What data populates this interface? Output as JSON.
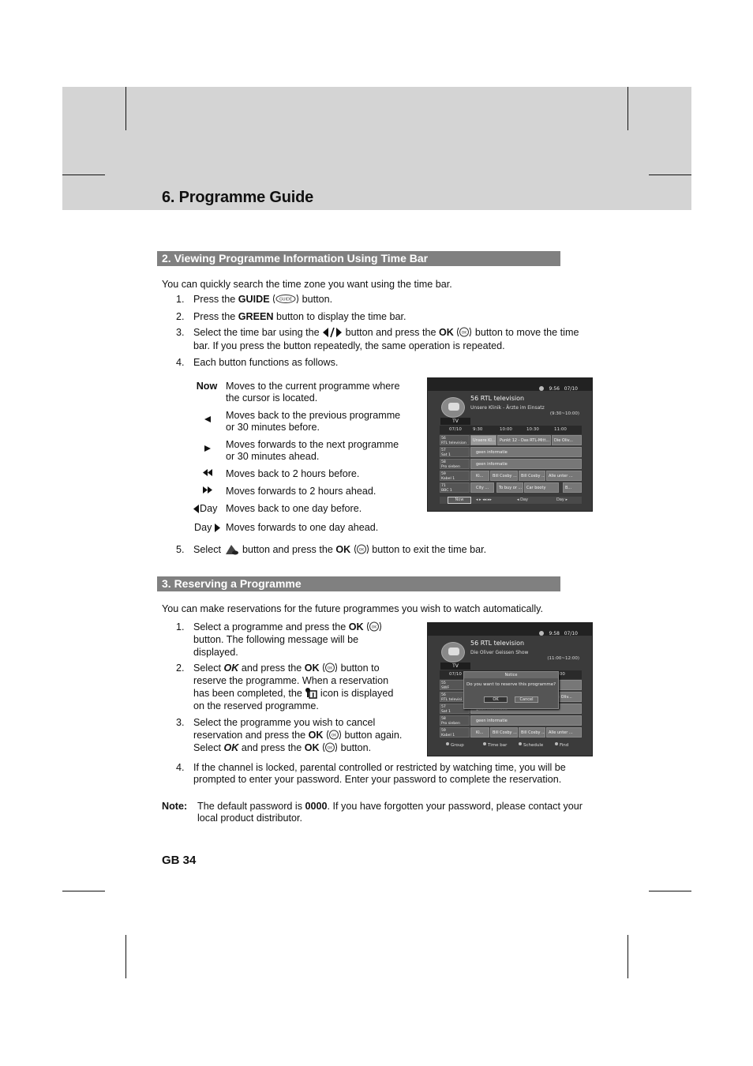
{
  "page": {
    "chapter_title": "6. Programme Guide",
    "page_number": "GB 34"
  },
  "section2": {
    "heading": "2. Viewing Programme Information Using Time Bar",
    "intro": "You can quickly search the time zone you want using the time bar.",
    "steps": [
      {
        "num": "1.",
        "pre": "Press the ",
        "bold": "GUIDE",
        "icon": "guide-button-icon",
        "post": " button."
      },
      {
        "num": "2.",
        "pre": "Press the ",
        "bold": "GREEN",
        "post": " button to display the time bar."
      },
      {
        "num": "3.",
        "pre": "Select the time bar using the ",
        "icon1": "left-right-arrow-icon",
        "mid": " button and press the ",
        "bold": "OK",
        "icon2": "ok-button-icon",
        "post": " button to move the time",
        "line2": "bar. If you press the button repeatedly, the same operation is repeated."
      },
      {
        "num": "4.",
        "text": "Each button functions as follows."
      },
      {
        "num": "5.",
        "pre": "Select ",
        "icon1": "exit-button-icon",
        "mid": " button and press the ",
        "bold": "OK",
        "icon2": "ok-button-icon",
        "post": " button to exit the time bar."
      }
    ],
    "functions": [
      {
        "key": "Now",
        "icon": "",
        "lines": [
          "Moves to the current programme where",
          "the cursor is located."
        ]
      },
      {
        "key": "",
        "icon": "left-arrow-icon",
        "lines": [
          "Moves back to the previous programme",
          "or 30 minutes before."
        ]
      },
      {
        "key": "",
        "icon": "right-arrow-icon",
        "lines": [
          "Moves forwards to the next programme",
          "or 30 minutes ahead."
        ]
      },
      {
        "key": "",
        "icon": "rewind-icon",
        "lines": [
          "Moves back to 2 hours before."
        ]
      },
      {
        "key": "",
        "icon": "fast-forward-icon",
        "lines": [
          "Moves forwards to 2 hours ahead."
        ]
      },
      {
        "key": "Day",
        "icon": "day-back-icon",
        "lines": [
          "Moves back to one day before."
        ]
      },
      {
        "key": "Day",
        "icon": "day-forward-icon",
        "lines": [
          "Moves forwards to one day ahead."
        ]
      }
    ]
  },
  "section3": {
    "heading": "3. Reserving a Programme",
    "intro": "You can make reservations for the future programmes you wish to watch automatically.",
    "steps": [
      {
        "num": "1.",
        "lines": [
          "Select a programme and press the |OK|",
          "button. The following message will be",
          "displayed."
        ]
      },
      {
        "num": "2.",
        "lines": [
          "Select OK and press the OK button to",
          "reserve the programme. When a reservation",
          "has been completed, the icon is displayed",
          "on the reserved programme."
        ]
      },
      {
        "num": "3.",
        "lines": [
          "Select the programme you wish to cancel",
          "reservation and press the OK button again.",
          "Select OK and press the OK button."
        ]
      },
      {
        "num": "4.",
        "lines": [
          "If the channel is locked, parental controlled or restricted by watching time, you will be",
          "prompted to enter your password. Enter your password to complete the reservation."
        ]
      }
    ],
    "words": {
      "select": "Select ",
      "ok": "OK",
      "and_press_the": " and press the ",
      "button_to": " button to",
      "button_again": " button again.",
      "button_end": " button.",
      "s1a": "Select a programme and press the ",
      "s1b": "button. The following message will be",
      "s1c": "displayed.",
      "s2b": "reserve the programme. When a reservation",
      "s2c_pre": "has been completed, the ",
      "s2c_post": " icon is displayed",
      "s2d": "on the reserved programme.",
      "s3a": "Select the programme you wish to cancel",
      "s3b": "reservation and press the ",
      "s4a": "If the channel is locked, parental controlled or restricted by watching time, you will be",
      "s4b": "prompted to enter your password. Enter your password to complete the reservation."
    }
  },
  "note": {
    "label": "Note:",
    "pre": "The default password is ",
    "password": "0000",
    "post": ". If you have forgotten your password, please contact your",
    "line2": "local product distributor."
  },
  "screen1": {
    "clock": "9:56",
    "date": "07/10",
    "channel": "56 RTL television",
    "programme": "Unsere Klinik - Ärzte im Einsatz",
    "time_range": "(9:30~10:00)",
    "tab": "TV",
    "head": {
      "date": "07/10",
      "t1": "9:30",
      "t2": "10:00",
      "t3": "10:30",
      "t4": "11:00"
    },
    "rows": [
      {
        "num": "56",
        "name": "RTL television",
        "progs": [
          "Unsere Kl...",
          "Punkt 12 - Das RTL-Mitt...",
          "Die Oliv..."
        ]
      },
      {
        "num": "57",
        "name": "Sat 1",
        "progs": [
          "geen informatie"
        ]
      },
      {
        "num": "58",
        "name": "Pro sieben",
        "progs": [
          "geen informatie"
        ]
      },
      {
        "num": "59",
        "name": "Kabel 1",
        "progs": [
          "Ki...",
          "Bill Cosby ...",
          "Bill Cosby ...",
          "Alle unter ..."
        ]
      },
      {
        "num": "71",
        "name": "BBC 1",
        "progs": [
          "City ...",
          "To buy or ...",
          "Car booty",
          "B..."
        ]
      }
    ],
    "nav": {
      "now": "Now",
      "day_back": "◂ Day",
      "day_fwd": "Day ▸"
    }
  },
  "screen2": {
    "clock": "9:58",
    "date": "07/10",
    "channel": "56 RTL television",
    "programme": "Die Oliver Geissen Show",
    "time_range": "(11:00~12:00)",
    "tab": "TV",
    "head": {
      "date": "07/10",
      "t4": ":00"
    },
    "rows": [
      {
        "num": "55",
        "name": "SWF",
        "progs": [
          ""
        ]
      },
      {
        "num": "56",
        "name": "RTL televisi",
        "progs": [
          "e Oliv..."
        ]
      },
      {
        "num": "57",
        "name": "Sat 1",
        "progs": [
          "geen informatie"
        ]
      },
      {
        "num": "58",
        "name": "Pro sieben",
        "progs": [
          "geen informatie"
        ]
      },
      {
        "num": "59",
        "name": "Kabel 1",
        "progs": [
          "Ki...",
          "Bill Cosby ...",
          "Bill Cosby ...",
          "Alle unter ..."
        ]
      }
    ],
    "dialog": {
      "title": "Notice",
      "message": "Do you want to reserve this programme?",
      "ok": "OK",
      "cancel": "Cancel"
    },
    "legend": {
      "group": "Group",
      "timebar": "Time bar",
      "schedule": "Schedule",
      "find": "Find"
    }
  }
}
